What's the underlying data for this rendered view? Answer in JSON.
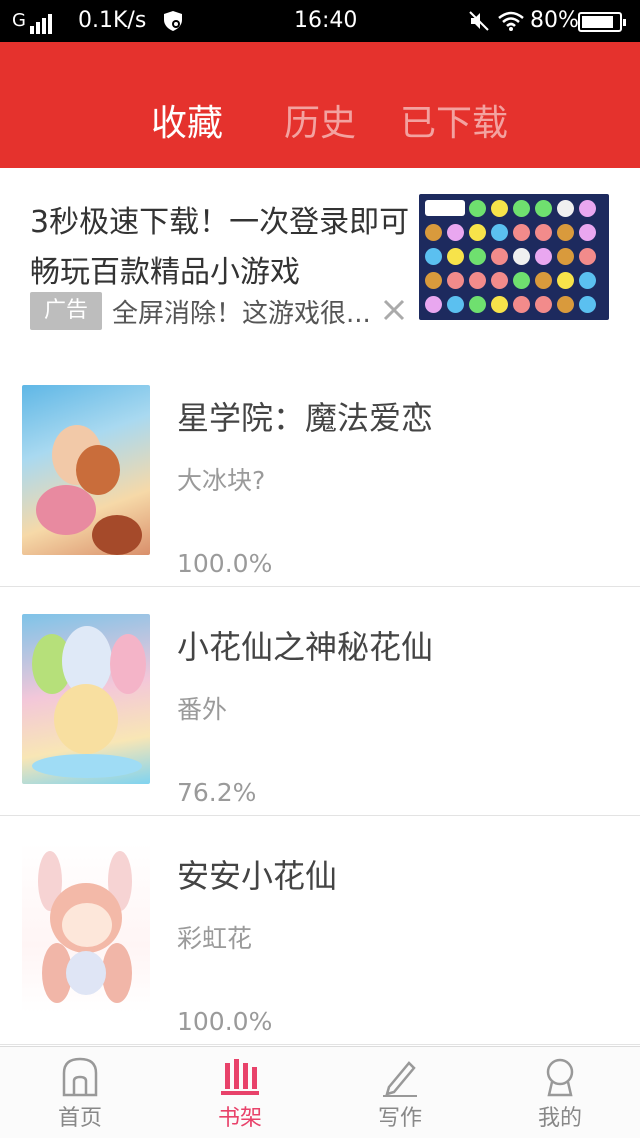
{
  "status_bar": {
    "network": "G",
    "speed": "0.1K/s",
    "time": "16:40",
    "battery": "80%"
  },
  "header": {
    "tabs": [
      {
        "label": "收藏",
        "active": true
      },
      {
        "label": "历史",
        "active": false
      },
      {
        "label": "已下载",
        "active": false
      }
    ]
  },
  "ad": {
    "title": "3秒极速下载！一次登录即可畅玩百款精品小游戏",
    "tag": "广告",
    "subtitle": "全屏消除！这游戏很..."
  },
  "books": [
    {
      "title": "星学院：魔法爱恋",
      "chapter": "大冰块?",
      "progress": "100.0%"
    },
    {
      "title": "小花仙之神秘花仙",
      "chapter": "番外",
      "progress": "76.2%"
    },
    {
      "title": "安安小花仙",
      "chapter": "彩虹花",
      "progress": "100.0%"
    }
  ],
  "bottom_nav": [
    {
      "label": "首页",
      "icon": "home-icon",
      "active": false
    },
    {
      "label": "书架",
      "icon": "bookshelf-icon",
      "active": true
    },
    {
      "label": "写作",
      "icon": "pencil-icon",
      "active": false
    },
    {
      "label": "我的",
      "icon": "profile-icon",
      "active": false
    }
  ],
  "colors": {
    "header": "#e5322d",
    "active_nav": "#e8426a"
  }
}
